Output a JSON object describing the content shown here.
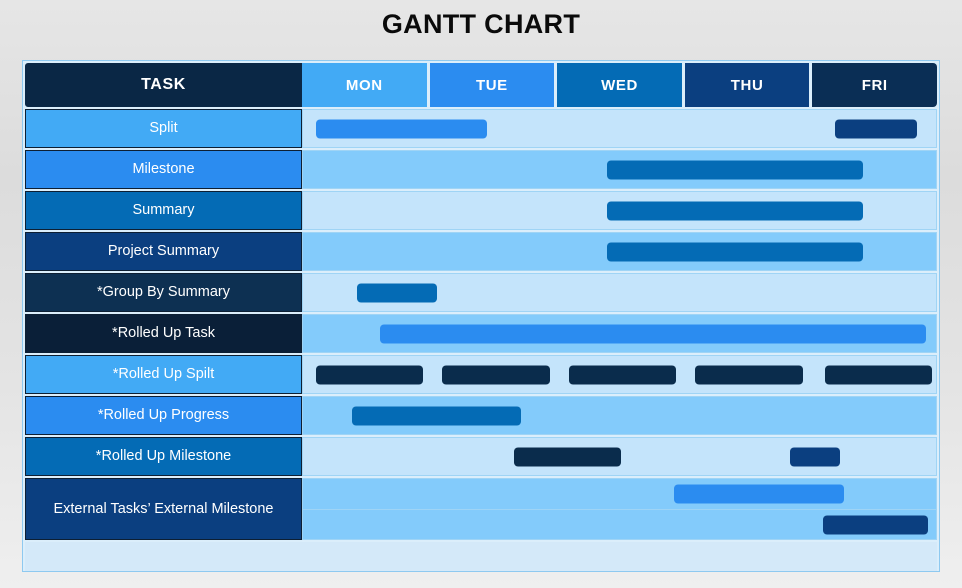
{
  "title": "GANTT CHART",
  "header": {
    "task_label": "TASK",
    "days": [
      {
        "label": "MON",
        "color": "#42aaf5"
      },
      {
        "label": "TUE",
        "color": "#2b8cf0"
      },
      {
        "label": "WED",
        "color": "#046bb5"
      },
      {
        "label": "THU",
        "color": "#0b3f80"
      },
      {
        "label": "FRI",
        "color": "#0a2e55"
      }
    ]
  },
  "palette": {
    "row_bg_light": "#c4e4fb",
    "row_bg_medium": "#83cbfb",
    "frame_border": "#8ec9f0",
    "bar_bright": "#2b8cf0",
    "bar_medium": "#046bb5",
    "bar_navy": "#0b3f80",
    "bar_darknavy": "#0a2c4c"
  },
  "chart_data": {
    "type": "bar",
    "title": "GANTT CHART",
    "xlabel": "",
    "ylabel": "",
    "categories": [
      "MON",
      "TUE",
      "WED",
      "THU",
      "FRI"
    ],
    "axis_note": "Each day column spans 1/5 of the timeline width; bar start/end given as day fractions 0..5",
    "rows": [
      {
        "task": "Split",
        "label_color": "#42aaf5",
        "row_bg": "#c4e4fb",
        "bars": [
          {
            "start": 0.1,
            "end": 1.45,
            "color": "#2b8cf0"
          },
          {
            "start": 4.2,
            "end": 4.85,
            "color": "#0b3f80"
          }
        ]
      },
      {
        "task": "Milestone",
        "label_color": "#2b8cf0",
        "row_bg": "#83cbfb",
        "bars": [
          {
            "start": 2.4,
            "end": 4.42,
            "color": "#046bb5"
          }
        ]
      },
      {
        "task": "Summary",
        "label_color": "#046bb5",
        "row_bg": "#c4e4fb",
        "bars": [
          {
            "start": 2.4,
            "end": 4.42,
            "color": "#046bb5"
          }
        ]
      },
      {
        "task": "Project Summary",
        "label_color": "#0b3f80",
        "row_bg": "#83cbfb",
        "bars": [
          {
            "start": 2.4,
            "end": 4.42,
            "color": "#046bb5"
          }
        ]
      },
      {
        "task": "*Group By Summary",
        "label_color": "#0d3052",
        "row_bg": "#c4e4fb",
        "bars": [
          {
            "start": 0.43,
            "end": 1.06,
            "color": "#046bb5"
          }
        ]
      },
      {
        "task": "*Rolled Up Task",
        "label_color": "#0a1f38",
        "row_bg": "#83cbfb",
        "bars": [
          {
            "start": 0.61,
            "end": 4.92,
            "color": "#2b8cf0"
          }
        ]
      },
      {
        "task": "*Rolled Up Spilt",
        "label_color": "#42aaf5",
        "row_bg": "#c4e4fb",
        "bars": [
          {
            "start": 0.1,
            "end": 0.95,
            "color": "#0a2c4c"
          },
          {
            "start": 1.1,
            "end": 1.95,
            "color": "#0a2c4c"
          },
          {
            "start": 2.1,
            "end": 2.95,
            "color": "#0a2c4c"
          },
          {
            "start": 3.1,
            "end": 3.95,
            "color": "#0a2c4c"
          },
          {
            "start": 4.12,
            "end": 4.97,
            "color": "#0a2c4c"
          }
        ]
      },
      {
        "task": "*Rolled Up Progress",
        "label_color": "#2b8cf0",
        "row_bg": "#83cbfb",
        "bars": [
          {
            "start": 0.39,
            "end": 1.72,
            "color": "#046bb5"
          }
        ]
      },
      {
        "task": "*Rolled Up Milestone",
        "label_color": "#046bb5",
        "row_bg": "#c4e4fb",
        "bars": [
          {
            "start": 1.67,
            "end": 2.51,
            "color": "#0a2c4c"
          },
          {
            "start": 3.85,
            "end": 4.24,
            "color": "#0b3f80"
          }
        ]
      },
      {
        "task": "External Tasks’ External Milestone",
        "label_color": "#0b3f80",
        "row_bg": "#83cbfb",
        "tall": true,
        "subrows": [
          {
            "bars": [
              {
                "start": 2.93,
                "end": 4.27,
                "color": "#2b8cf0"
              }
            ]
          },
          {
            "bars": [
              {
                "start": 4.11,
                "end": 4.94,
                "color": "#0b3f80"
              }
            ]
          }
        ]
      }
    ]
  }
}
